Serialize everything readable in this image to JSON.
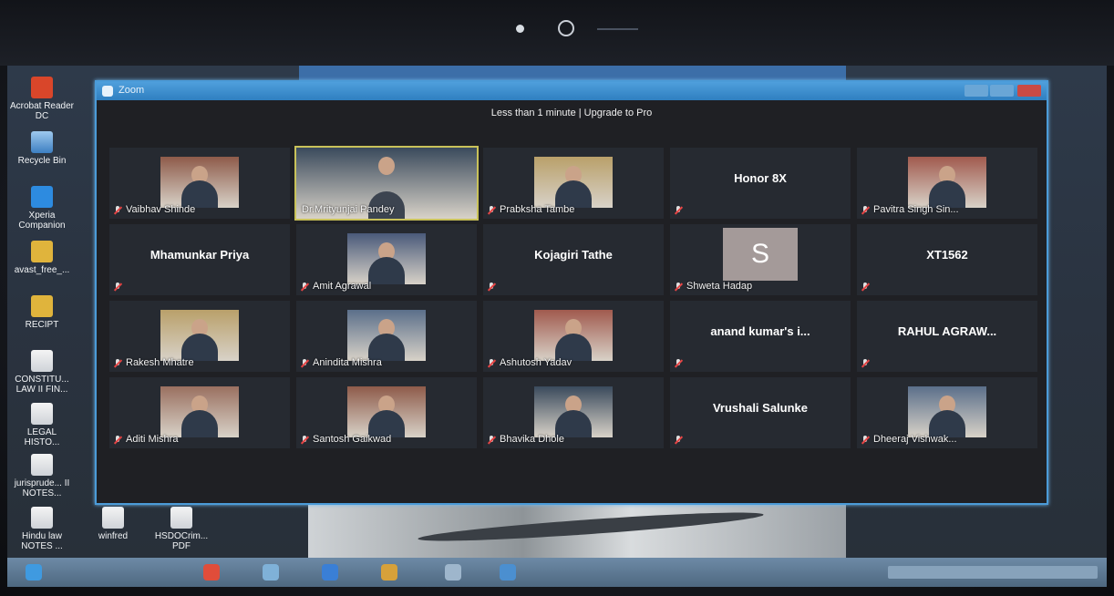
{
  "desktop": {
    "icons": [
      {
        "label": "Acrobat Reader DC"
      },
      {
        "label": "Recycle Bin"
      },
      {
        "label": "Xperia Companion"
      },
      {
        "label": "avast_free_..."
      },
      {
        "label": "RECIPT"
      },
      {
        "label": "CONSTITU... LAW II FIN..."
      },
      {
        "label": "LEGAL HISTO..."
      },
      {
        "label": "jurisprude... II NOTES..."
      },
      {
        "label": "Hindu law NOTES ..."
      },
      {
        "label": "winfred"
      },
      {
        "label": "HSDOCrim... PDF"
      }
    ]
  },
  "zoom": {
    "window_title": "Zoom",
    "banner": "Less than 1 minute | Upgrade to Pro",
    "participants": [
      {
        "name": "Vaibhav Shinde",
        "video": true,
        "muted": true
      },
      {
        "name": "Dr.Mrityunjai Pandey",
        "video": true,
        "muted": false,
        "active": true
      },
      {
        "name": "Prabksha Tambe",
        "video": true,
        "muted": true
      },
      {
        "name": "Honor 8X",
        "video": false,
        "muted": true
      },
      {
        "name": "Pavitra Singh Sin...",
        "video": true,
        "muted": true
      },
      {
        "name": "Mhamunkar Priya",
        "video": false,
        "muted": true
      },
      {
        "name": "Amit Agrawal",
        "video": true,
        "muted": true
      },
      {
        "name": "Kojagiri Tathe",
        "video": false,
        "muted": true
      },
      {
        "name": "Shweta Hadap",
        "video": false,
        "muted": true,
        "avatar_letter": "S"
      },
      {
        "name": "XT1562",
        "video": false,
        "muted": true
      },
      {
        "name": "Rakesh Mhatre",
        "video": true,
        "muted": true
      },
      {
        "name": "Anindita Mishra",
        "video": true,
        "muted": true
      },
      {
        "name": "Ashutosh Yadav",
        "video": true,
        "muted": true
      },
      {
        "name": "anand kumar's i...",
        "video": false,
        "muted": true
      },
      {
        "name": "RAHUL AGRAW...",
        "video": false,
        "muted": true
      },
      {
        "name": "Aditi Mishra",
        "video": true,
        "muted": true
      },
      {
        "name": "Santosh Gaikwad",
        "video": true,
        "muted": true
      },
      {
        "name": "Bhavika Dhole",
        "video": true,
        "muted": true
      },
      {
        "name": "Vrushali Salunke",
        "video": false,
        "muted": true
      },
      {
        "name": "Dheeraj Vishwak...",
        "video": true,
        "muted": true
      }
    ]
  },
  "colors": {
    "zoom_blue": "#2f7fc0",
    "active_speaker_border": "#c9c25a",
    "muted_red": "#e64545"
  }
}
